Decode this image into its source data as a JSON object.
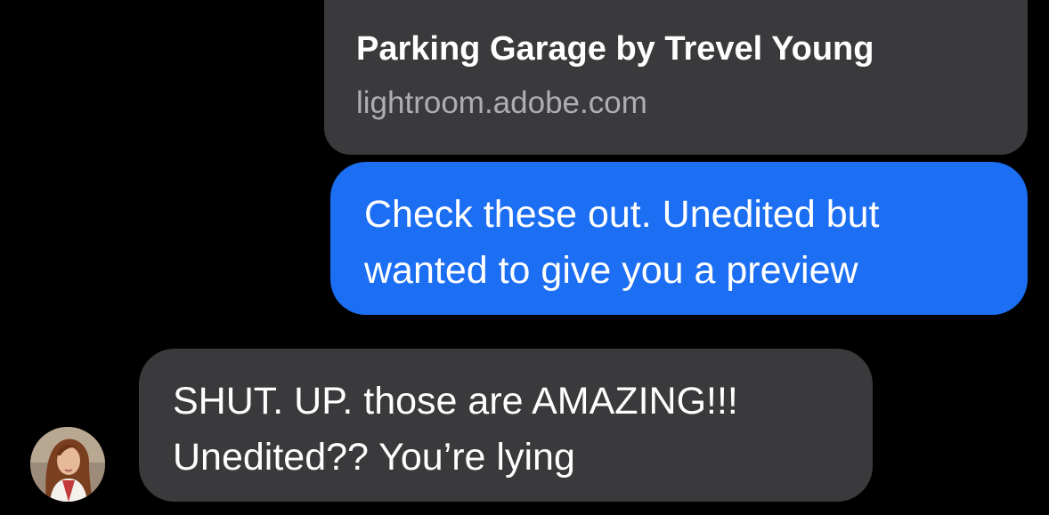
{
  "link_preview": {
    "title": "Parking Garage by Trevel Young",
    "domain": "lightroom.adobe.com"
  },
  "messages": [
    {
      "direction": "outgoing",
      "lines": [
        "Check these out. Unedited but",
        "wanted to give you a preview"
      ]
    },
    {
      "direction": "incoming",
      "lines": [
        "SHUT. UP. those are AMAZING!!!",
        "Unedited?? You’re lying"
      ]
    }
  ],
  "contact": {
    "avatar_icon": "contact-photo-icon"
  },
  "colors": {
    "background": "#000000",
    "incoming_bubble": "#3a3a3c",
    "outgoing_bubble": "#1c6ef2",
    "domain_text": "#aeaeb2"
  }
}
